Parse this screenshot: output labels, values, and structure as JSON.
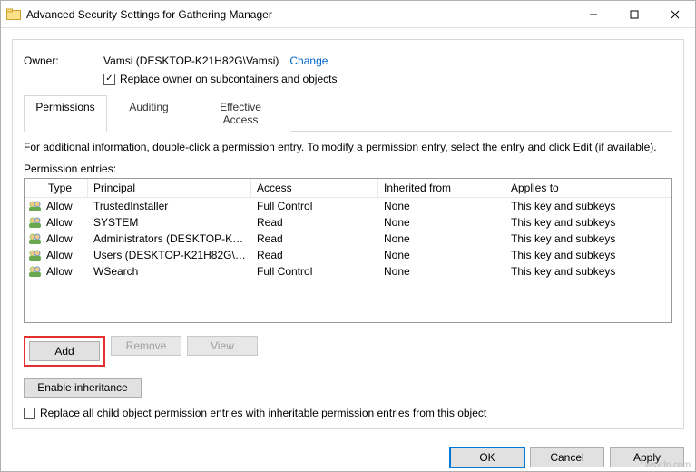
{
  "window": {
    "title": "Advanced Security Settings for Gathering Manager"
  },
  "owner": {
    "label": "Owner:",
    "value": "Vamsi (DESKTOP-K21H82G\\Vamsi)",
    "change": "Change",
    "replace_checked": true,
    "replace_label": "Replace owner on subcontainers and objects"
  },
  "tabs": {
    "permissions": "Permissions",
    "auditing": "Auditing",
    "effective": "Effective Access"
  },
  "info": "For additional information, double-click a permission entry. To modify a permission entry, select the entry and click Edit (if available).",
  "entries_label": "Permission entries:",
  "columns": {
    "type": "Type",
    "principal": "Principal",
    "access": "Access",
    "inherited": "Inherited from",
    "applies": "Applies to"
  },
  "rows": [
    {
      "type": "Allow",
      "principal": "TrustedInstaller",
      "access": "Full Control",
      "inherited": "None",
      "applies": "This key and subkeys"
    },
    {
      "type": "Allow",
      "principal": "SYSTEM",
      "access": "Read",
      "inherited": "None",
      "applies": "This key and subkeys"
    },
    {
      "type": "Allow",
      "principal": "Administrators (DESKTOP-K21...",
      "access": "Read",
      "inherited": "None",
      "applies": "This key and subkeys"
    },
    {
      "type": "Allow",
      "principal": "Users (DESKTOP-K21H82G\\Us...",
      "access": "Read",
      "inherited": "None",
      "applies": "This key and subkeys"
    },
    {
      "type": "Allow",
      "principal": "WSearch",
      "access": "Full Control",
      "inherited": "None",
      "applies": "This key and subkeys"
    }
  ],
  "buttons": {
    "add": "Add",
    "remove": "Remove",
    "view": "View",
    "enable_inh": "Enable inheritance",
    "ok": "OK",
    "cancel": "Cancel",
    "apply": "Apply"
  },
  "lower_cb": {
    "checked": false,
    "label": "Replace all child object permission entries with inheritable permission entries from this object"
  },
  "watermark": "wsxdn.com"
}
